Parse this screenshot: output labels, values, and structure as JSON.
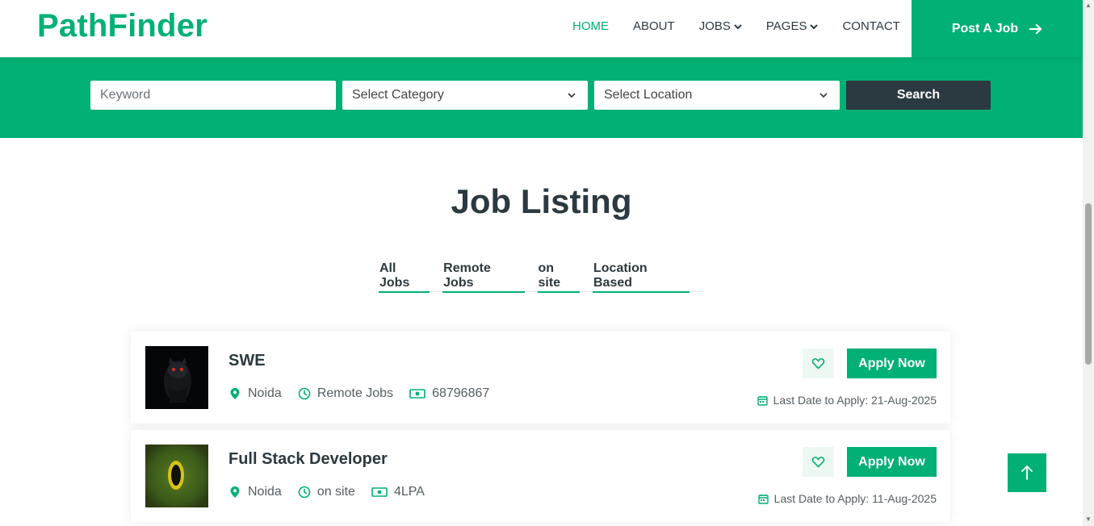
{
  "brand": {
    "name": "PathFinder",
    "color": "#00b074"
  },
  "nav": {
    "items": [
      {
        "label": "HOME",
        "active": true
      },
      {
        "label": "ABOUT"
      },
      {
        "label": "JOBS",
        "dropdown": true
      },
      {
        "label": "PAGES",
        "dropdown": true
      },
      {
        "label": "CONTACT"
      }
    ],
    "cta_label": "Post A Job"
  },
  "search": {
    "keyword_placeholder": "Keyword",
    "category_label": "Select Category",
    "location_label": "Select Location",
    "button_label": "Search"
  },
  "listing": {
    "title": "Job Listing",
    "tabs": [
      "All Jobs",
      "Remote Jobs",
      "on site",
      "Location Based"
    ],
    "jobs": [
      {
        "title": "SWE",
        "location": "Noida",
        "type": "Remote Jobs",
        "salary": "68796867",
        "apply_label": "Apply Now",
        "deadline": "Last Date to Apply: 21-Aug-2025",
        "thumb_icon": "owl-image"
      },
      {
        "title": "Full Stack Developer",
        "location": "Noida",
        "type": "on site",
        "salary": "4LPA",
        "apply_label": "Apply Now",
        "deadline": "Last Date to Apply: 11-Aug-2025",
        "thumb_icon": "green-glow-image"
      }
    ]
  },
  "colors": {
    "accent": "#00b074",
    "dark": "#2b3940"
  }
}
